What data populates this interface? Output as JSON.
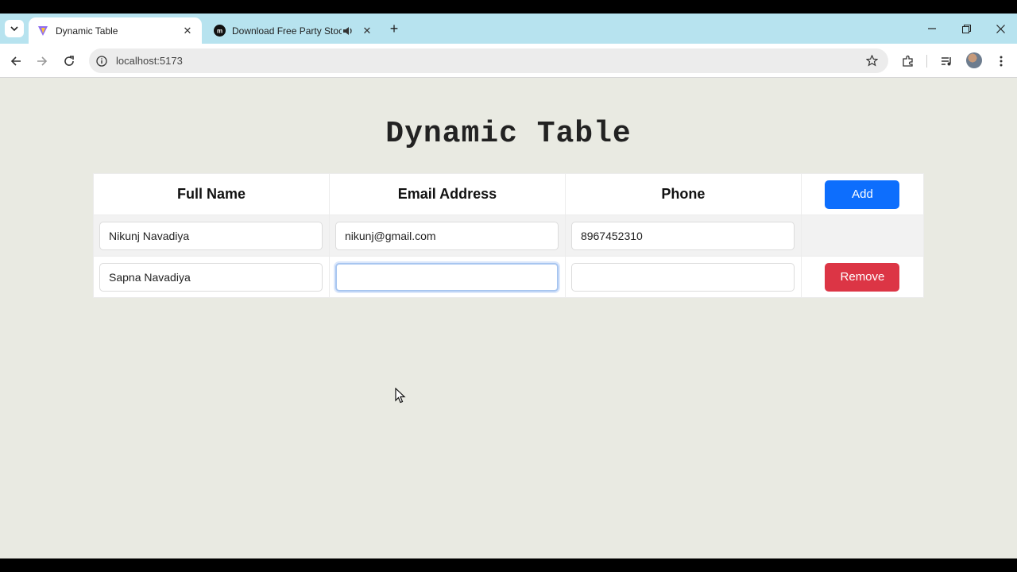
{
  "browser": {
    "tabs": [
      {
        "title": "Dynamic Table",
        "active": true
      },
      {
        "title": "Download Free Party Stock",
        "active": false
      }
    ],
    "url": "localhost:5173"
  },
  "page": {
    "heading": "Dynamic Table",
    "table": {
      "headers": [
        "Full Name",
        "Email Address",
        "Phone"
      ],
      "add_label": "Add",
      "rows": [
        {
          "full_name": "Nikunj Navadiya",
          "email": "nikunj@gmail.com",
          "phone": "8967452310",
          "remove_label": ""
        },
        {
          "full_name": "Sapna Navadiya",
          "email": "",
          "phone": "",
          "remove_label": "Remove"
        }
      ]
    }
  },
  "colors": {
    "tab_strip": "#b7e3ef",
    "page_bg": "#e9eae2",
    "add_button": "#0d6efd",
    "remove_button": "#dc3545"
  }
}
